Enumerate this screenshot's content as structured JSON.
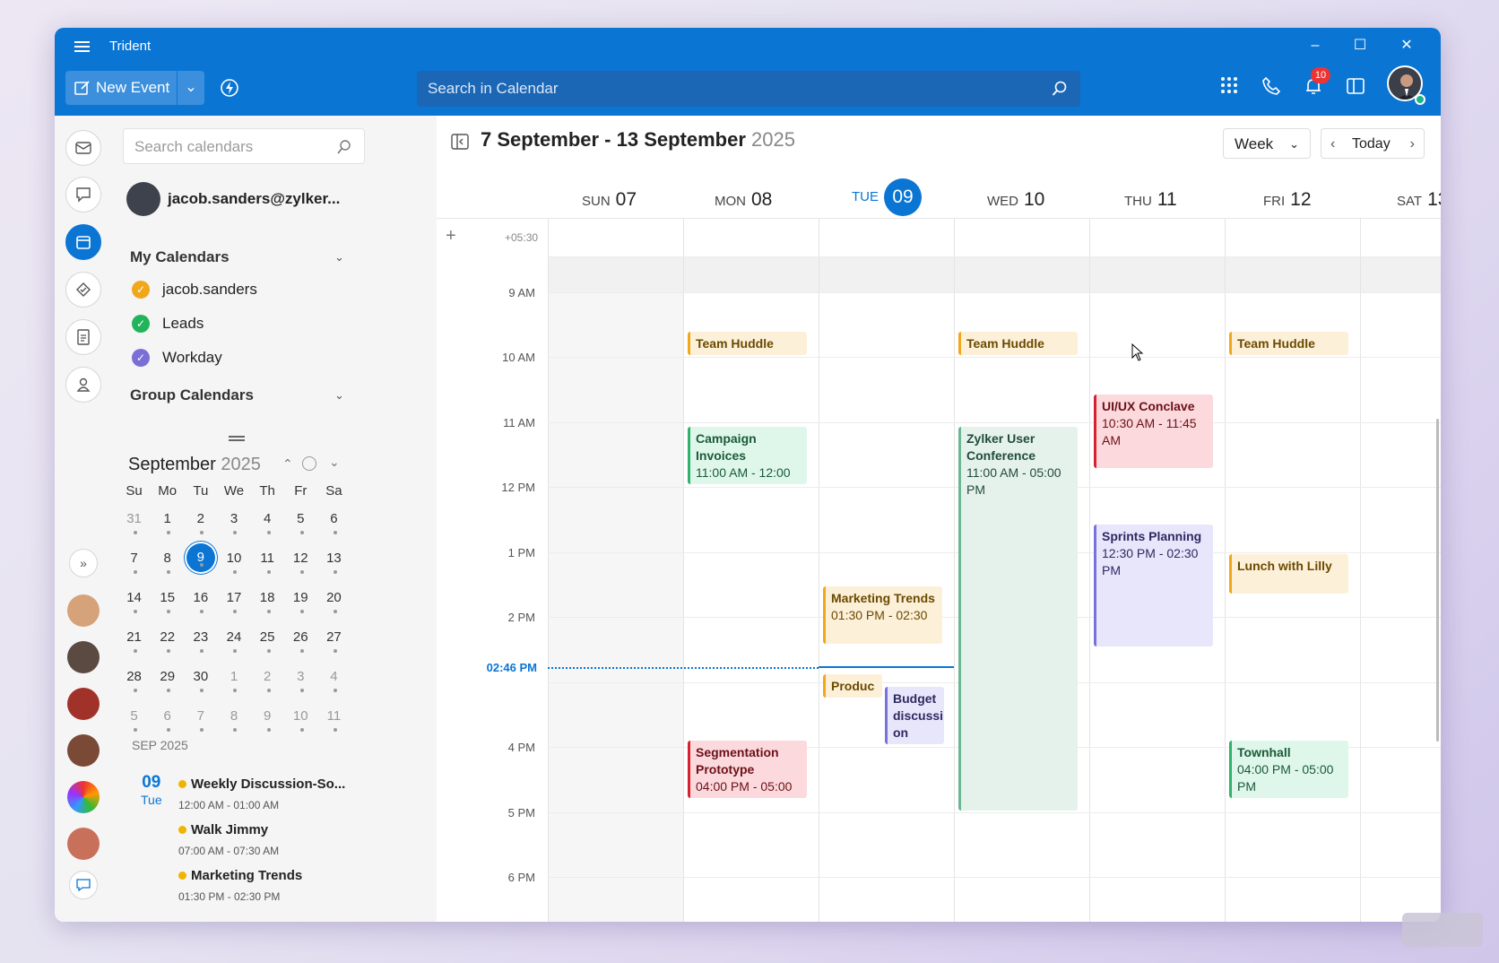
{
  "app": {
    "title": "Trident"
  },
  "toolbar": {
    "new_event_label": "New Event",
    "search_placeholder": "Search in Calendar",
    "notifications_count": "10"
  },
  "sidebar": {
    "search_placeholder": "Search calendars",
    "account": "jacob.sanders@zylker...",
    "my_calendars_label": "My Calendars",
    "my_calendars": [
      {
        "name": "jacob.sanders",
        "color": "#f0a81a"
      },
      {
        "name": "Leads",
        "color": "#22b45a"
      },
      {
        "name": "Workday",
        "color": "#7a6fd6"
      }
    ],
    "group_calendars_label": "Group Calendars",
    "mini_calendar": {
      "month": "September",
      "year": "2025",
      "weekdays": [
        "Su",
        "Mo",
        "Tu",
        "We",
        "Th",
        "Fr",
        "Sa"
      ],
      "weeks": [
        [
          "31",
          "1",
          "2",
          "3",
          "4",
          "5",
          "6"
        ],
        [
          "7",
          "8",
          "9",
          "10",
          "11",
          "12",
          "13"
        ],
        [
          "14",
          "15",
          "16",
          "17",
          "18",
          "19",
          "20"
        ],
        [
          "21",
          "22",
          "23",
          "24",
          "25",
          "26",
          "27"
        ],
        [
          "28",
          "29",
          "30",
          "1",
          "2",
          "3",
          "4"
        ],
        [
          "5",
          "6",
          "7",
          "8",
          "9",
          "10",
          "11"
        ]
      ],
      "selected": "9"
    },
    "agenda": {
      "month_label": "SEP 2025",
      "day_num": "09",
      "day_name": "Tue",
      "items": [
        {
          "title": "Weekly Discussion-So...",
          "time": "12:00 AM - 01:00 AM"
        },
        {
          "title": "Walk Jimmy",
          "time": "07:00 AM - 07:30 AM"
        },
        {
          "title": "Marketing Trends",
          "time": "01:30 PM - 02:30 PM"
        }
      ]
    }
  },
  "main": {
    "range_title": "7 September - 13 September",
    "range_year": "2025",
    "view_label": "Week",
    "today_label": "Today",
    "timezone": "+05:30",
    "days": [
      {
        "dow": "SUN",
        "num": "07"
      },
      {
        "dow": "MON",
        "num": "08"
      },
      {
        "dow": "TUE",
        "num": "09"
      },
      {
        "dow": "WED",
        "num": "10"
      },
      {
        "dow": "THU",
        "num": "11"
      },
      {
        "dow": "FRI",
        "num": "12"
      },
      {
        "dow": "SAT",
        "num": "13"
      }
    ],
    "hours": [
      "9 AM",
      "10 AM",
      "11 AM",
      "12 PM",
      "1 PM",
      "2 PM",
      "4 PM",
      "5 PM",
      "6 PM"
    ],
    "now_label": "02:46 PM",
    "events": [
      {
        "title": "Team Huddle",
        "time": ""
      },
      {
        "title": "Team Huddle",
        "time": ""
      },
      {
        "title": "Team Huddle",
        "time": ""
      },
      {
        "title": "UI/UX Conclave",
        "time": "10:30 AM - 11:45 AM"
      },
      {
        "title": "Campaign Invoices",
        "time": "11:00 AM - 12:00"
      },
      {
        "title": "Zylker User Conference",
        "time": "11:00 AM - 05:00 PM"
      },
      {
        "title": "Sprints Planning",
        "time": "12:30 PM - 02:30 PM"
      },
      {
        "title": "Lunch with Lilly",
        "time": ""
      },
      {
        "title": "Marketing Trends",
        "time": "01:30 PM - 02:30"
      },
      {
        "title": "Produc",
        "time": ""
      },
      {
        "title": "Budget discussi on",
        "time": ""
      },
      {
        "title": "Segmentation Prototype",
        "time": "04:00 PM - 05:00"
      },
      {
        "title": "Townhall",
        "time": "04:00 PM - 05:00 PM"
      }
    ]
  }
}
